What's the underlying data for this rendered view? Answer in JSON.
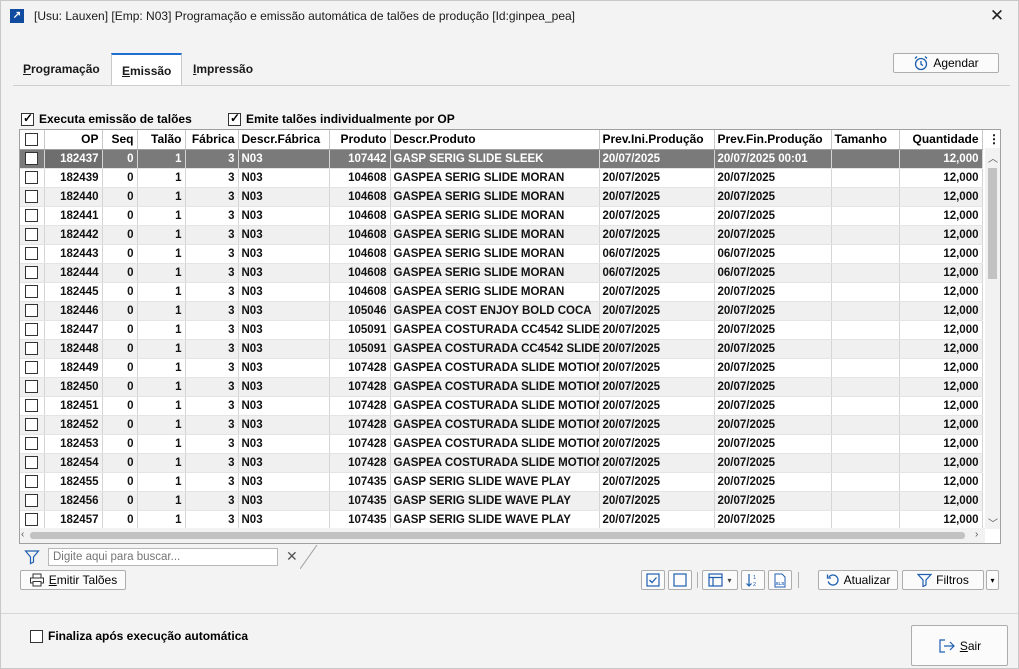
{
  "window": {
    "title": "[Usu: Lauxen] [Emp: N03] Programação e emissão automática de talões de produção [Id:ginpea_pea]",
    "close": "✕",
    "app_icon": "↗"
  },
  "tabs": [
    {
      "label": "Programação",
      "u": "P",
      "rest": "rogramação"
    },
    {
      "label": "Emissão",
      "u": "E",
      "rest": "missão"
    },
    {
      "label": "Impressão",
      "u": "I",
      "rest": "mpressão"
    }
  ],
  "agendar": {
    "label": "Agendar",
    "icon": "alarm-clock-icon"
  },
  "options": {
    "executa_emissao": {
      "label": "Executa emissão de talões",
      "checked": true
    },
    "emite_individualmente": {
      "label": "Emite talões individualmente por OP",
      "checked": true
    }
  },
  "grid": {
    "columns": [
      "OP",
      "Seq",
      "Talão",
      "Fábrica",
      "Descr.Fábrica",
      "Produto",
      "Descr.Produto",
      "Prev.Ini.Produção",
      "Prev.Fin.Produção",
      "Tamanho",
      "Quantidade"
    ],
    "menu_glyph": "⋮",
    "rows": [
      [
        "182437",
        "0",
        "1",
        "3",
        "N03",
        "107442",
        "GASP SERIG SLIDE SLEEK",
        "20/07/2025",
        "20/07/2025 00:01",
        "",
        "12,000"
      ],
      [
        "182439",
        "0",
        "1",
        "3",
        "N03",
        "104608",
        "GASPEA SERIG SLIDE MORAN",
        "20/07/2025",
        "20/07/2025",
        "",
        "12,000"
      ],
      [
        "182440",
        "0",
        "1",
        "3",
        "N03",
        "104608",
        "GASPEA SERIG SLIDE MORAN",
        "20/07/2025",
        "20/07/2025",
        "",
        "12,000"
      ],
      [
        "182441",
        "0",
        "1",
        "3",
        "N03",
        "104608",
        "GASPEA SERIG SLIDE MORAN",
        "20/07/2025",
        "20/07/2025",
        "",
        "12,000"
      ],
      [
        "182442",
        "0",
        "1",
        "3",
        "N03",
        "104608",
        "GASPEA SERIG SLIDE MORAN",
        "20/07/2025",
        "20/07/2025",
        "",
        "12,000"
      ],
      [
        "182443",
        "0",
        "1",
        "3",
        "N03",
        "104608",
        "GASPEA SERIG SLIDE MORAN",
        "06/07/2025",
        "06/07/2025",
        "",
        "12,000"
      ],
      [
        "182444",
        "0",
        "1",
        "3",
        "N03",
        "104608",
        "GASPEA SERIG SLIDE MORAN",
        "06/07/2025",
        "06/07/2025",
        "",
        "12,000"
      ],
      [
        "182445",
        "0",
        "1",
        "3",
        "N03",
        "104608",
        "GASPEA SERIG SLIDE MORAN",
        "20/07/2025",
        "20/07/2025",
        "",
        "12,000"
      ],
      [
        "182446",
        "0",
        "1",
        "3",
        "N03",
        "105046",
        "GASPEA COST ENJOY BOLD COCA",
        "20/07/2025",
        "20/07/2025",
        "",
        "12,000"
      ],
      [
        "182447",
        "0",
        "1",
        "3",
        "N03",
        "105091",
        "GASPEA COSTURADA CC4542 SLIDE",
        "20/07/2025",
        "20/07/2025",
        "",
        "12,000"
      ],
      [
        "182448",
        "0",
        "1",
        "3",
        "N03",
        "105091",
        "GASPEA COSTURADA CC4542 SLIDE",
        "20/07/2025",
        "20/07/2025",
        "",
        "12,000"
      ],
      [
        "182449",
        "0",
        "1",
        "3",
        "N03",
        "107428",
        "GASPEA COSTURADA SLIDE MOTION",
        "20/07/2025",
        "20/07/2025",
        "",
        "12,000"
      ],
      [
        "182450",
        "0",
        "1",
        "3",
        "N03",
        "107428",
        "GASPEA COSTURADA SLIDE MOTION",
        "20/07/2025",
        "20/07/2025",
        "",
        "12,000"
      ],
      [
        "182451",
        "0",
        "1",
        "3",
        "N03",
        "107428",
        "GASPEA COSTURADA SLIDE MOTION",
        "20/07/2025",
        "20/07/2025",
        "",
        "12,000"
      ],
      [
        "182452",
        "0",
        "1",
        "3",
        "N03",
        "107428",
        "GASPEA COSTURADA SLIDE MOTION",
        "20/07/2025",
        "20/07/2025",
        "",
        "12,000"
      ],
      [
        "182453",
        "0",
        "1",
        "3",
        "N03",
        "107428",
        "GASPEA COSTURADA SLIDE MOTION",
        "20/07/2025",
        "20/07/2025",
        "",
        "12,000"
      ],
      [
        "182454",
        "0",
        "1",
        "3",
        "N03",
        "107428",
        "GASPEA COSTURADA SLIDE MOTION",
        "20/07/2025",
        "20/07/2025",
        "",
        "12,000"
      ],
      [
        "182455",
        "0",
        "1",
        "3",
        "N03",
        "107435",
        "GASP SERIG SLIDE WAVE PLAY",
        "20/07/2025",
        "20/07/2025",
        "",
        "12,000"
      ],
      [
        "182456",
        "0",
        "1",
        "3",
        "N03",
        "107435",
        "GASP SERIG SLIDE WAVE PLAY",
        "20/07/2025",
        "20/07/2025",
        "",
        "12,000"
      ],
      [
        "182457",
        "0",
        "1",
        "3",
        "N03",
        "107435",
        "GASP SERIG SLIDE WAVE PLAY",
        "20/07/2025",
        "20/07/2025",
        "",
        "12,000"
      ]
    ]
  },
  "search": {
    "placeholder": "Digite aqui para buscar..."
  },
  "toolbar": {
    "emitir_u": "E",
    "emitir_rest": "mitir Talões",
    "atualizar": "Atualizar",
    "filtros": "Filtros"
  },
  "footer": {
    "finaliza": {
      "label": "Finaliza após execução automática",
      "checked": false
    },
    "sair_u": "S",
    "sair_rest": "air"
  }
}
